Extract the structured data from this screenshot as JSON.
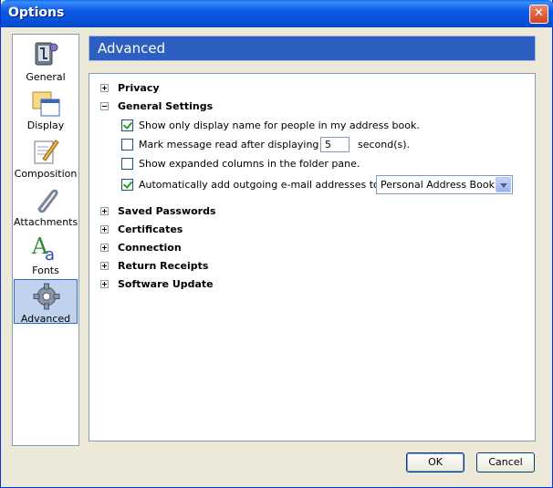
{
  "window": {
    "title": "Options",
    "close_glyph": "✕"
  },
  "sidebar": {
    "items": [
      {
        "label": "General",
        "icon": "general-icon",
        "selected": false
      },
      {
        "label": "Display",
        "icon": "display-icon",
        "selected": false
      },
      {
        "label": "Composition",
        "icon": "composition-icon",
        "selected": false
      },
      {
        "label": "Attachments",
        "icon": "attachments-icon",
        "selected": false
      },
      {
        "label": "Fonts",
        "icon": "fonts-icon",
        "selected": false
      },
      {
        "label": "Advanced",
        "icon": "advanced-icon",
        "selected": true
      }
    ]
  },
  "panel": {
    "header": "Advanced",
    "sections": {
      "privacy": "Privacy",
      "general_settings": "General Settings",
      "saved_passwords": "Saved Passwords",
      "certificates": "Certificates",
      "connection": "Connection",
      "return_receipts": "Return Receipts",
      "software_update": "Software Update"
    },
    "options": {
      "display_name": {
        "label": "Show only display name for people in my address book.",
        "checked": true
      },
      "mark_read": {
        "label": "Mark message read after displaying for",
        "checked": false,
        "value": "5",
        "unit": "second(s)."
      },
      "expanded_columns": {
        "label": "Show expanded columns in the folder pane.",
        "checked": false
      },
      "auto_add": {
        "label": "Automatically add outgoing e-mail addresses to my:",
        "checked": true,
        "selected": "Personal Address Book"
      }
    }
  },
  "buttons": {
    "ok": "OK",
    "cancel": "Cancel"
  },
  "colors": {
    "titlebar": "#0853dd",
    "header": "#2c5fc1",
    "selection": "#c1d2ee"
  }
}
